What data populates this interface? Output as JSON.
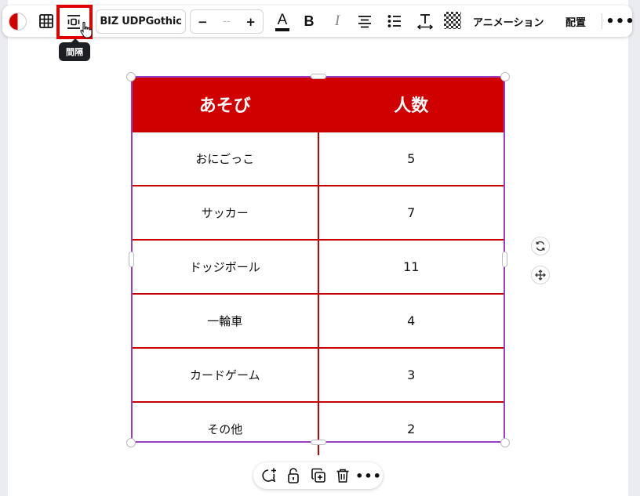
{
  "toolbar": {
    "color_swatch": {
      "icon": "color-swatch-icon",
      "colors": [
        "#d30000",
        "#ffffff"
      ]
    },
    "table_icon": "table-grid-icon",
    "spacing_icon": "spacing-icon",
    "font_name": "BIZ UDPGothic",
    "font_size": {
      "decrease": "−",
      "value": "--",
      "increase": "+"
    },
    "text_color_icon": "A",
    "bold_label": "B",
    "italic_label": "I",
    "align_icon": "align-center-icon",
    "list_icon": "bullet-list-icon",
    "text_spacing_icon": "text-spacing-icon",
    "transparency_icon": "transparency-icon",
    "animation_label": "アニメーション",
    "position_label": "配置",
    "more_label": "•••"
  },
  "tooltip": {
    "text": "間隔"
  },
  "highlight_color": "#e00000",
  "table": {
    "header_color": "#d00000",
    "border_color": "#c80000",
    "headers": [
      "あそび",
      "人数"
    ],
    "rows": [
      [
        "おにごっこ",
        "5"
      ],
      [
        "サッカー",
        "7"
      ],
      [
        "ドッジボール",
        "11"
      ],
      [
        "一輪車",
        "4"
      ],
      [
        "カードゲーム",
        "3"
      ],
      [
        "その他",
        "2"
      ]
    ]
  },
  "bottom_toolbar": {
    "icons": [
      "comment-add-icon",
      "lock-icon",
      "duplicate-icon",
      "trash-icon"
    ],
    "more_label": "•••"
  }
}
